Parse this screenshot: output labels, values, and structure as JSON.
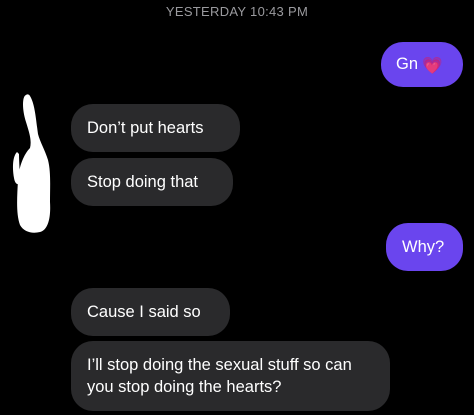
{
  "header": {
    "timestamp": "YESTERDAY 10:43 PM"
  },
  "messages": [
    {
      "direction": "sent",
      "text": "Gn",
      "emoji": "💗"
    },
    {
      "direction": "received",
      "text": "Don’t put hearts"
    },
    {
      "direction": "received",
      "text": "Stop doing that"
    },
    {
      "direction": "sent",
      "text": "Why?"
    },
    {
      "direction": "received",
      "text": "Cause I said so"
    },
    {
      "direction": "received",
      "text": "I’ll stop doing the sexual stuff so can you stop doing the hearts?"
    }
  ],
  "colors": {
    "background": "#000000",
    "sent_bubble": "#6a45ee",
    "received_bubble": "#2a2a2c",
    "timestamp_text": "#9a9a9e"
  }
}
